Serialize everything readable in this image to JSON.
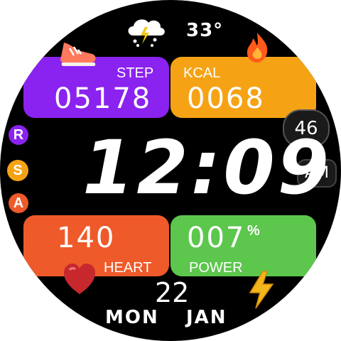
{
  "weather": {
    "icon": "thunderstorm-cloud-icon",
    "temperature": "33°"
  },
  "step": {
    "label": "STEP",
    "value": "05178",
    "icon": "sneaker-icon",
    "color": "#8a22f0"
  },
  "kcal": {
    "label": "KCAL",
    "value": "0068",
    "icon": "flame-icon",
    "color": "#f5a315"
  },
  "heart": {
    "label": "HEART",
    "value": "140",
    "icon": "heart-icon",
    "color": "#ee5a2a"
  },
  "power": {
    "label": "POWER",
    "value": "007",
    "unit": "%",
    "icon": "lightning-bolt-icon",
    "color": "#5cc64d"
  },
  "time": {
    "display": "12:09",
    "seconds": "46",
    "ampm": "AM"
  },
  "shortcuts": [
    {
      "letter": "R",
      "color": "#8a22f0"
    },
    {
      "letter": "S",
      "color": "#f5a315"
    },
    {
      "letter": "A",
      "color": "#ee5a2a"
    }
  ],
  "date": {
    "day": "22",
    "weekday": "MON",
    "month": "JAN"
  }
}
